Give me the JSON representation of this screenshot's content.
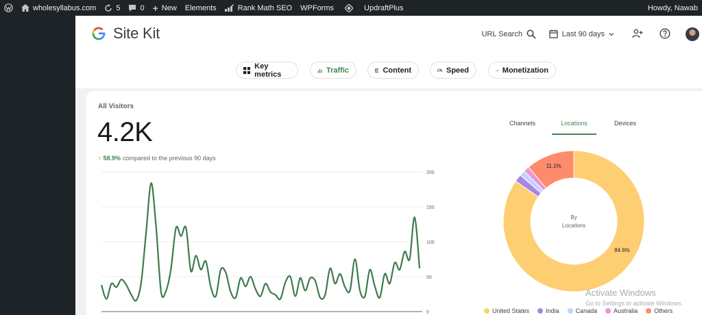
{
  "admin_bar": {
    "site_name": "wholesyllabus.com",
    "updates_count": "5",
    "comments_count": "0",
    "new_label": "New",
    "elements_label": "Elements",
    "rankmath_label": "Rank Math SEO",
    "wpforms_label": "WPForms",
    "updraft_label": "UpdraftPlus",
    "greeting": "Howdy, Nawab"
  },
  "header": {
    "logo_text": "Site Kit",
    "url_search_label": "URL Search",
    "date_range_label": "Last 90 days"
  },
  "nav_chips": [
    {
      "label": "Key metrics",
      "icon": "grid-icon",
      "active": false
    },
    {
      "label": "Traffic",
      "icon": "bar-chart-icon",
      "active": true
    },
    {
      "label": "Content",
      "icon": "content-icon",
      "active": false
    },
    {
      "label": "Speed",
      "icon": "speedometer-icon",
      "active": false
    },
    {
      "label": "Monetization",
      "icon": "trending-icon",
      "active": false
    }
  ],
  "visitors": {
    "title": "All Visitors",
    "value": "4.2K",
    "change_value": "58.9%",
    "change_text": "compared to the previous 90 days"
  },
  "tabs": [
    {
      "label": "Channels",
      "active": false
    },
    {
      "label": "Locations",
      "active": true
    },
    {
      "label": "Devices",
      "active": false
    }
  ],
  "watermark": {
    "title": "Activate Windows",
    "subtitle": "Go to Settings to activate Windows."
  },
  "colors": {
    "accent": "#3e8550",
    "line": "#3c7a4b",
    "united_states": "#fece72",
    "india": "#a983e6",
    "canada": "#bed4ff",
    "australia": "#ee92da",
    "others": "#ff8b6d"
  },
  "chart_data": [
    {
      "type": "line",
      "title": "",
      "xlabel": "",
      "ylabel": "",
      "ylim": [
        0,
        200
      ],
      "yticks": [
        "200",
        "150",
        "100",
        "50",
        "0"
      ],
      "grid": true,
      "series": [
        {
          "values": [
            38,
            18,
            40,
            35,
            46,
            38,
            24,
            16,
            42,
            115,
            184,
            120,
            28,
            30,
            62,
            120,
            108,
            120,
            58,
            80,
            60,
            72,
            35,
            22,
            60,
            56,
            28,
            20,
            48,
            36,
            50,
            32,
            22,
            40,
            28,
            24,
            18,
            42,
            50,
            22,
            48,
            30,
            48,
            44,
            20,
            24,
            62,
            40,
            54,
            35,
            30,
            75,
            30,
            22,
            60,
            36,
            20,
            54,
            40,
            70,
            60,
            86,
            75,
            135,
            62
          ]
        }
      ]
    },
    {
      "type": "pie",
      "title": "",
      "center_label": "By Locations",
      "legend": "bottom",
      "categories": [
        "United States",
        "India",
        "Canada",
        "Australia",
        "Others"
      ],
      "values": [
        84.6,
        1.7,
        1.3,
        1.3,
        11.1
      ],
      "slice_labels": {
        "United States": "84.6%",
        "Others": "11.1%"
      }
    }
  ]
}
